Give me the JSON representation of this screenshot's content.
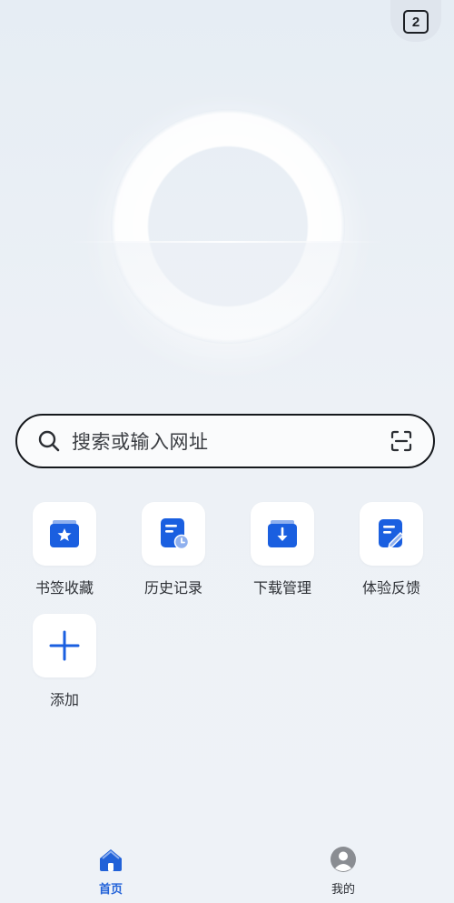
{
  "header": {
    "tab_count": "2"
  },
  "search": {
    "placeholder": "搜索或输入网址"
  },
  "shortcuts": [
    {
      "label": "书签收藏",
      "icon": "bookmark-star-icon"
    },
    {
      "label": "历史记录",
      "icon": "history-document-icon"
    },
    {
      "label": "下载管理",
      "icon": "download-folder-icon"
    },
    {
      "label": "体验反馈",
      "icon": "feedback-edit-icon"
    },
    {
      "label": "添加",
      "icon": "plus-icon"
    }
  ],
  "bottom_nav": {
    "home_label": "首页",
    "mine_label": "我的"
  },
  "colors": {
    "accent": "#2262d8",
    "icon_blue": "#1a5fe0",
    "background": "#edf1f6"
  }
}
